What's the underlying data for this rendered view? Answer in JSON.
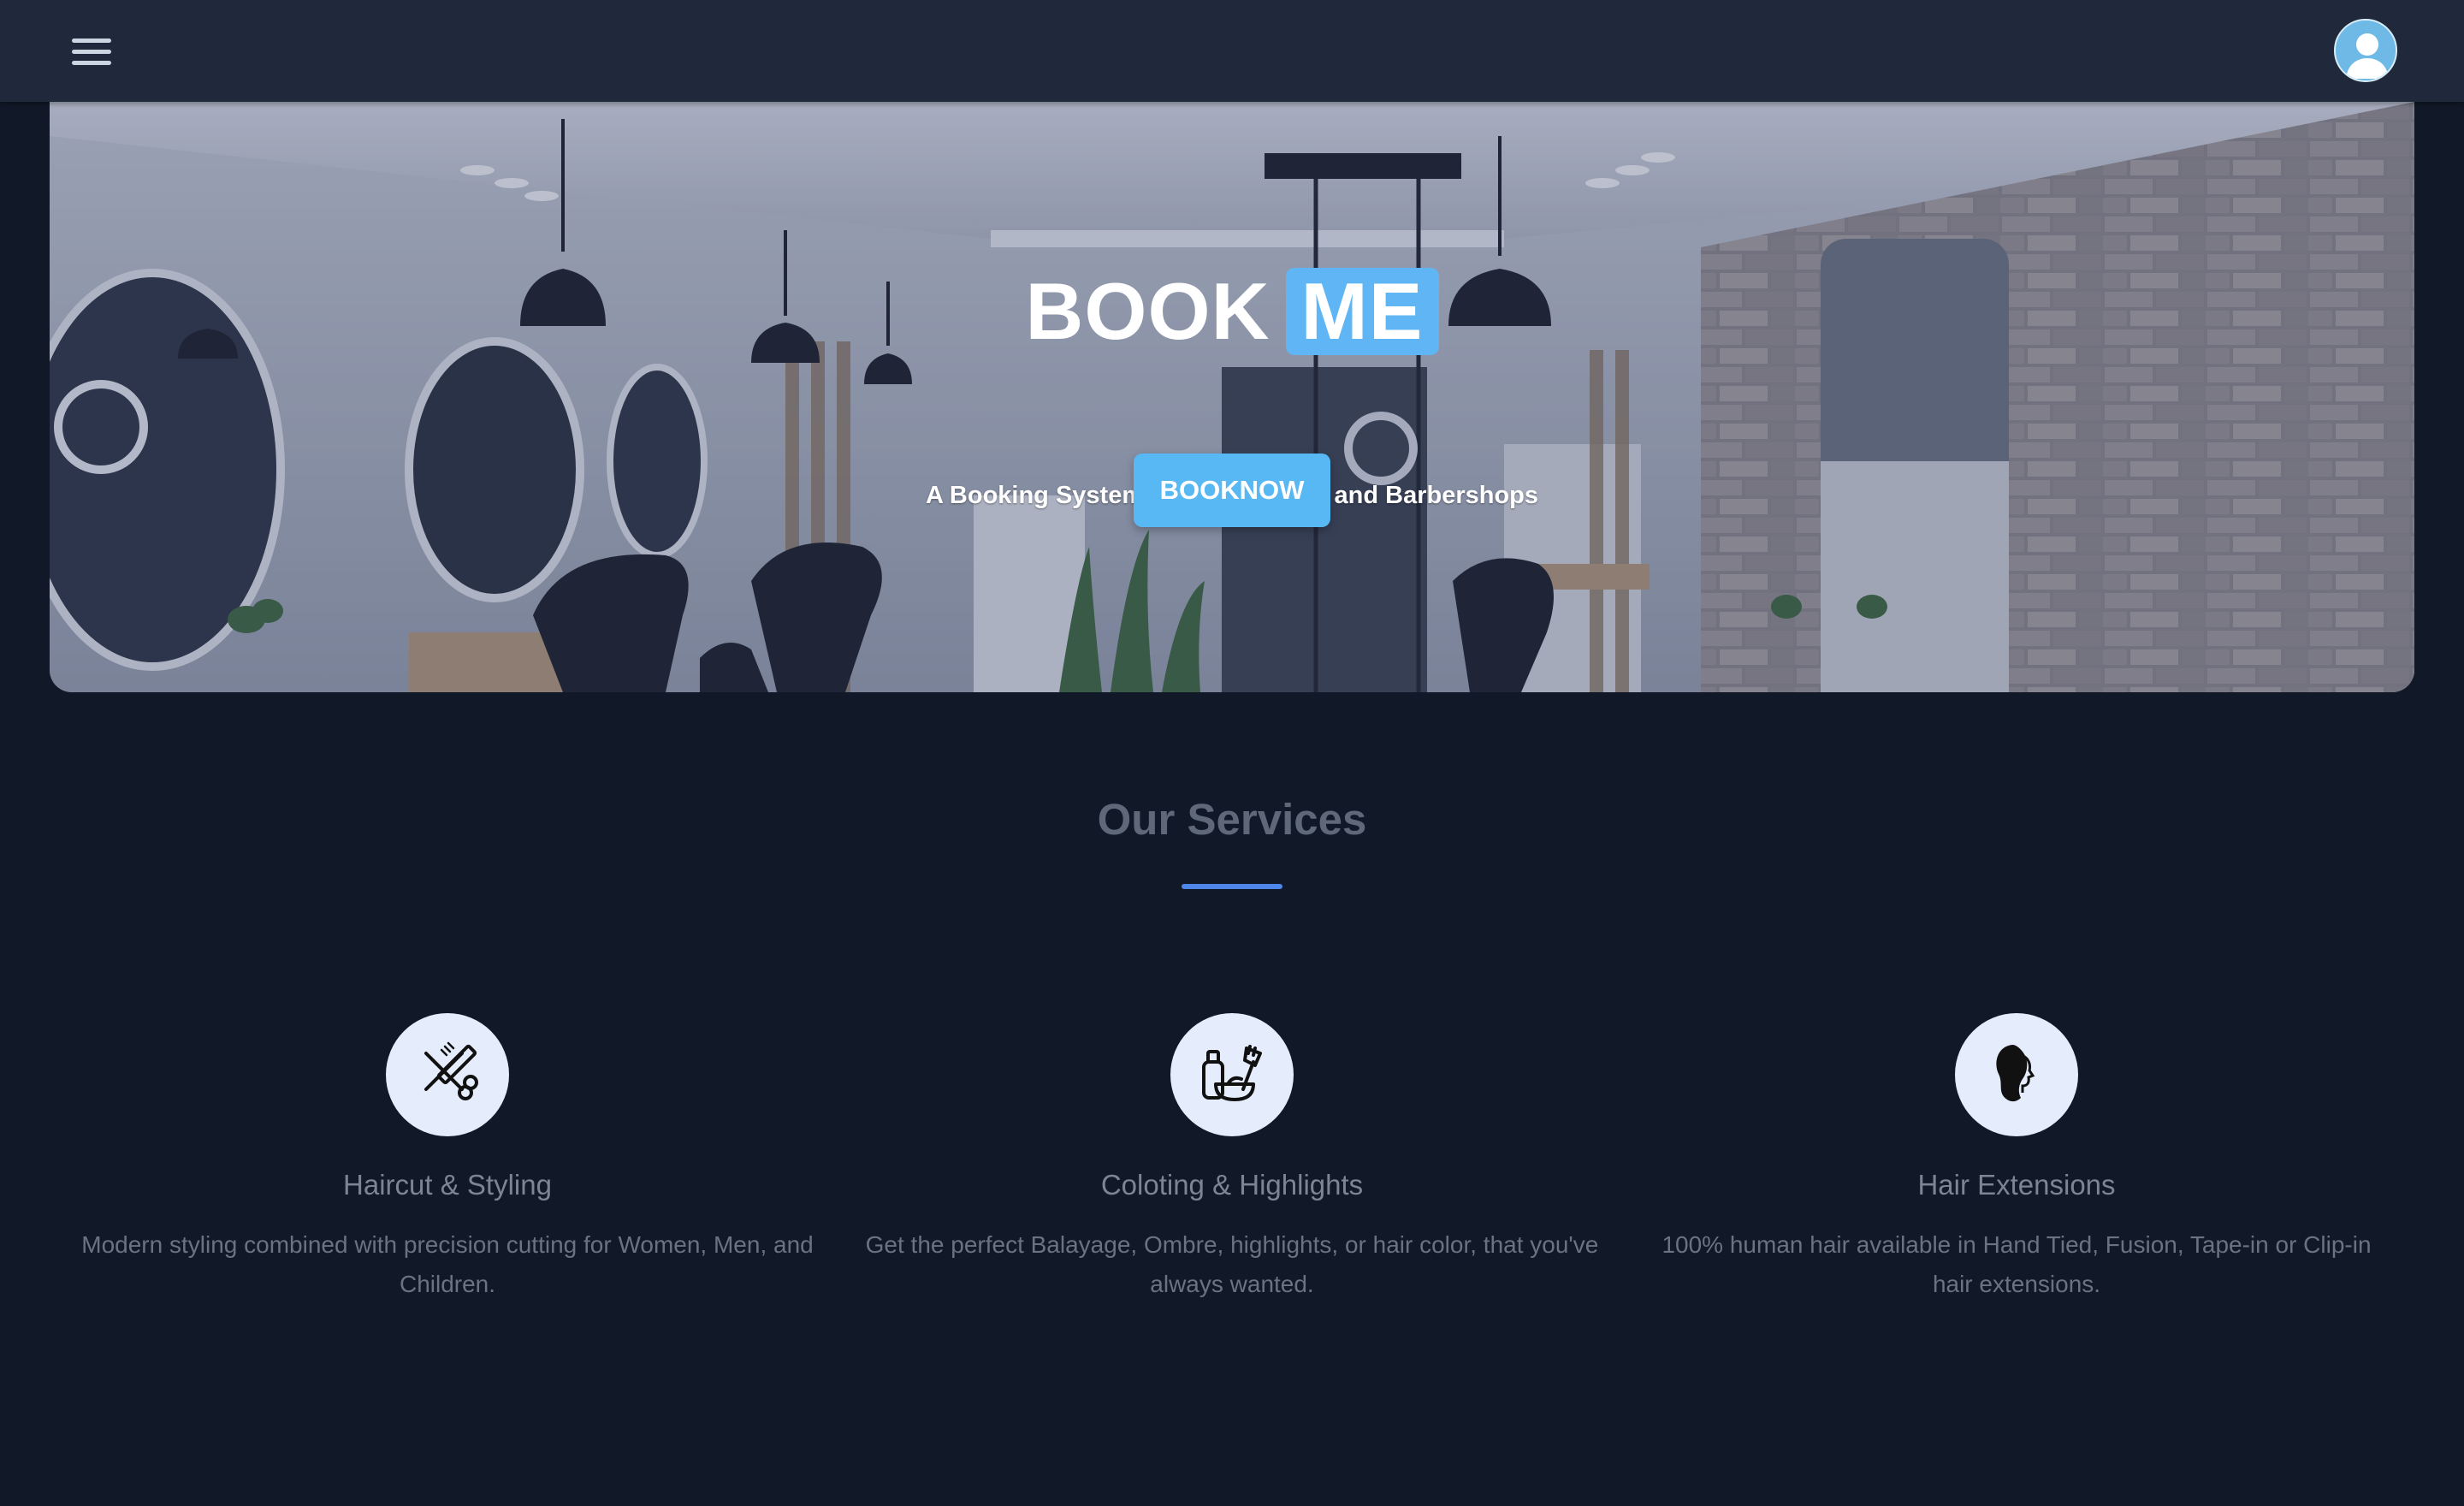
{
  "nav": {
    "menu_icon": "hamburger-menu-icon",
    "avatar_icon": "user-avatar-icon"
  },
  "hero": {
    "brand_word1": "BOOK",
    "brand_word2": "ME",
    "tagline": "A Booking System for Hair Salons and Barbershops",
    "cta_label": "BOOKNOW",
    "accent_color": "#60b6f4"
  },
  "services": {
    "title": "Our Services",
    "items": [
      {
        "icon": "scissors-comb-icon",
        "name": "Haircut & Styling",
        "description": "Modern styling combined with precision cutting for Women, Men, and Children."
      },
      {
        "icon": "hair-dye-bowl-icon",
        "name": "Coloting & Highlights",
        "description": "Get the perfect Balayage, Ombre, highlights, or hair color, that you've always wanted."
      },
      {
        "icon": "woman-hair-profile-icon",
        "name": "Hair Extensions",
        "description": "100% human hair available in Hand Tied, Fusion, Tape-in or Clip-in hair extensions."
      }
    ]
  }
}
